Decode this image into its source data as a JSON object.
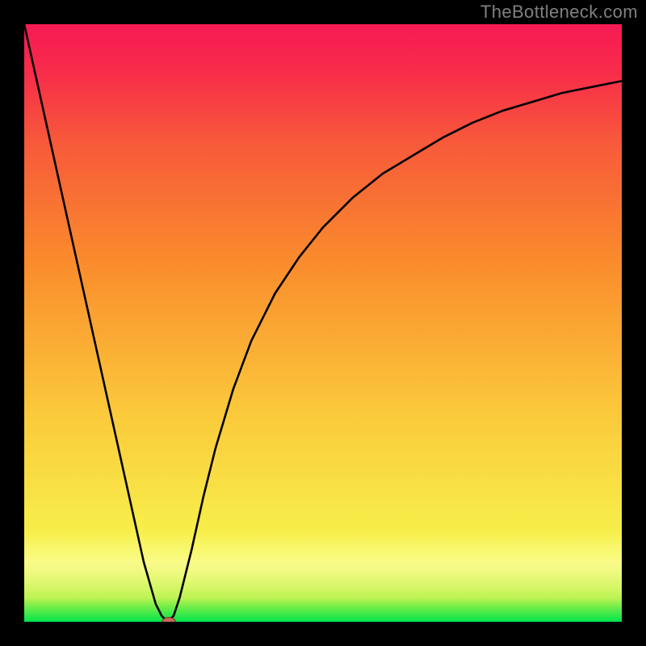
{
  "watermark": "TheBottleneck.com",
  "chart_data": {
    "type": "line",
    "title": "",
    "xlabel": "",
    "ylabel": "",
    "xlim": [
      0,
      100
    ],
    "ylim": [
      0,
      100
    ],
    "grid": false,
    "legend": false,
    "background_gradient": {
      "stops": [
        {
          "pos": 0.0,
          "color": "#00e54b"
        },
        {
          "pos": 0.04,
          "color": "#b8f24a"
        },
        {
          "pos": 0.1,
          "color": "#f6f84e"
        },
        {
          "pos": 0.35,
          "color": "#fbc93b"
        },
        {
          "pos": 0.6,
          "color": "#fa8c2c"
        },
        {
          "pos": 0.8,
          "color": "#f75a3a"
        },
        {
          "pos": 0.92,
          "color": "#f72c4a"
        },
        {
          "pos": 1.0,
          "color": "#f71a54"
        }
      ],
      "direction": "bottom-to-top"
    },
    "series": [
      {
        "name": "bottleneck-curve",
        "x": [
          0,
          2,
          4,
          6,
          8,
          10,
          12,
          14,
          16,
          18,
          20,
          22,
          23,
          24,
          25,
          26,
          28,
          30,
          32,
          35,
          38,
          42,
          46,
          50,
          55,
          60,
          65,
          70,
          75,
          80,
          85,
          90,
          95,
          100
        ],
        "y": [
          100,
          91,
          82,
          73,
          64,
          55,
          46,
          37,
          28,
          19,
          10,
          3,
          1,
          0,
          1,
          4,
          12,
          21,
          29,
          39,
          47,
          55,
          61,
          66,
          71,
          75,
          78,
          81,
          83.5,
          85.5,
          87,
          88.5,
          89.5,
          90.5
        ]
      }
    ],
    "marker": {
      "name": "optimal-point",
      "x": 24,
      "y": 0,
      "color": "#c46a55",
      "rx": 8,
      "ry": 6
    }
  },
  "layout": {
    "outer_size": 800,
    "border_px": 30
  }
}
